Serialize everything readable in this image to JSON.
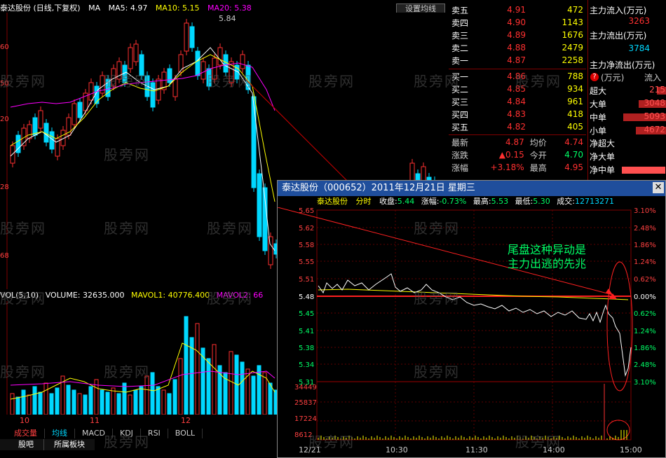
{
  "kline": {
    "title": "泰达股份",
    "mode": "(日线,下复权)",
    "ma_label": "MA",
    "ma5": "MA5: 4.97",
    "ma10": "MA10: 5.15",
    "ma20": "MA20: 5.38",
    "high_marker": "5.84",
    "settings_button": "设置均线",
    "y_ticks": [
      "60",
      "50",
      "20",
      "28",
      "68"
    ],
    "volume_header": "VOL(5,10)",
    "volume": "VOLUME: 32635.000",
    "mavol1": "MAVOL1: 40776.400",
    "mavol2": "MAVOL2: 66",
    "month_labels": [
      "10",
      "11",
      "12"
    ],
    "tabs": [
      "成交量",
      "均线",
      "MACD",
      "KDJ",
      "RSI",
      "BOLL"
    ],
    "bottom_tabs": [
      "股吧",
      "所属板块"
    ]
  },
  "quote": {
    "sells": [
      {
        "label": "卖五",
        "price": "4.91",
        "vol": "472"
      },
      {
        "label": "卖四",
        "price": "4.90",
        "vol": "1143"
      },
      {
        "label": "卖三",
        "price": "4.89",
        "vol": "1676"
      },
      {
        "label": "卖二",
        "price": "4.88",
        "vol": "2479"
      },
      {
        "label": "卖一",
        "price": "4.87",
        "vol": "2258"
      }
    ],
    "buys": [
      {
        "label": "买一",
        "price": "4.86",
        "vol": "788"
      },
      {
        "label": "买二",
        "price": "4.85",
        "vol": "934"
      },
      {
        "label": "买三",
        "price": "4.84",
        "vol": "961"
      },
      {
        "label": "买四",
        "price": "4.83",
        "vol": "418"
      },
      {
        "label": "买五",
        "price": "4.82",
        "vol": "405"
      }
    ],
    "latest_label": "最新",
    "latest": "4.87",
    "avg_label": "均价",
    "avg": "4.74",
    "change_label": "涨跌",
    "change": "▲0.15",
    "open_label": "今开",
    "open": "4.70",
    "pct_label": "涨幅",
    "pct": "+3.18%",
    "high_label": "最高",
    "high": "4.95"
  },
  "fund": {
    "inflow_label": "主力流入(万元)",
    "inflow": "3263",
    "outflow_label": "主力流出(万元)",
    "outflow": "3784",
    "net_label": "主力净流出(万元)",
    "unit_label": "(万元)",
    "flow_in_label": "流入",
    "rows": [
      {
        "label": "超大",
        "value": "215"
      },
      {
        "label": "大单",
        "value": "3048"
      },
      {
        "label": "中单",
        "value": "5093"
      },
      {
        "label": "小单",
        "value": "4672"
      }
    ],
    "net_rows": [
      "净超大",
      "净大单",
      "净中单"
    ]
  },
  "popup": {
    "title": "泰达股份（000652）2011年12月21日 星期三",
    "info_name": "泰达股份",
    "info_mode": "分时",
    "close_label": "收盘:",
    "close_value": "5.44",
    "chg_label": "涨幅:",
    "chg_value": "-0.73%",
    "high_label": "最高:",
    "high_value": "5.53",
    "low_label": "最低:",
    "low_value": "5.30",
    "vol_label": "成交:",
    "vol_value": "12713271",
    "left_ticks": [
      "5.65",
      "5.62",
      "5.58",
      "5.55",
      "5.51",
      "5.48",
      "5.45",
      "5.41",
      "5.38",
      "5.34",
      "5.31"
    ],
    "right_ticks": [
      "3.10%",
      "2.48%",
      "1.86%",
      "1.24%",
      "0.62%",
      "0.00%",
      "0.62%",
      "1.24%",
      "1.86%",
      "2.48%",
      "3.10%"
    ],
    "vol_ticks": [
      "34449",
      "25837",
      "17224",
      "8612"
    ],
    "time_labels": [
      "12/21",
      "10:30",
      "11:30",
      "14:00",
      "15:00"
    ],
    "annotation_line1": "尾盘这种异动是",
    "annotation_line2": "主力出逃的先兆"
  },
  "watermark": "股旁网",
  "colors": {
    "up": "#ff3030",
    "down": "#00d8ff",
    "yellow": "#ffff00",
    "magenta": "#ff00ff",
    "green": "#00ff66"
  }
}
